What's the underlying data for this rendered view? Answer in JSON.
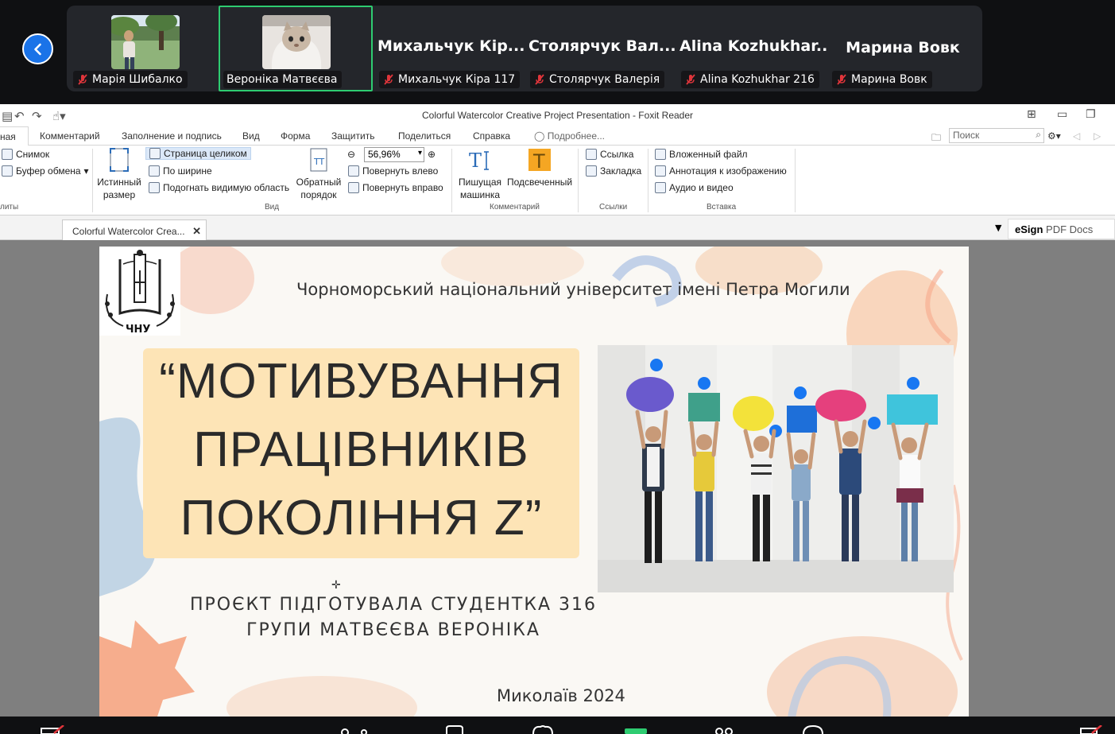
{
  "participants": [
    {
      "name": "Марія Шибалко",
      "muted": true,
      "has_video": true
    },
    {
      "name": "Вероніка Матвєєва",
      "muted": false,
      "has_video": true,
      "active": true
    },
    {
      "display": "Михальчук Кір...",
      "name": "Михальчук Кіра 117",
      "muted": true
    },
    {
      "display": "Столярчук Вал...",
      "name": "Столярчук Валерія",
      "muted": true
    },
    {
      "display": "Alina Kozhukhar...",
      "name": "Alina Kozhukhar 216",
      "muted": true
    },
    {
      "display": "Марина Вовк",
      "name": "Марина Вовк",
      "muted": true
    }
  ],
  "window": {
    "title": "Colorful Watercolor Creative Project Presentation - Foxit Reader"
  },
  "menu": {
    "home": "ная",
    "items": [
      "Комментарий",
      "Заполнение и подпись",
      "Вид",
      "Форма",
      "Защитить",
      "Поделиться",
      "Справка",
      "Подробнее..."
    ],
    "search_placeholder": "Поиск"
  },
  "ribbon": {
    "snapshot": "Снимок",
    "clipboard": "Буфер обмена",
    "tools_group": "литы",
    "actual_size": [
      "Истинный",
      "размер"
    ],
    "fit_page": "Страница целиком",
    "fit_width": "По ширине",
    "fit_visible": "Подогнать видимую область",
    "view_group": "Вид",
    "reverse_order": [
      "Обратный",
      "порядок"
    ],
    "zoom": "56,96%",
    "rotate_left": "Повернуть влево",
    "rotate_right": "Повернуть вправо",
    "typewriter": [
      "Пишущая",
      "машинка"
    ],
    "highlight": "Подсвеченный",
    "comments_group": "Комментарий",
    "link": "Ссылка",
    "bookmark": "Закладка",
    "links_group": "Ссылки",
    "attachment": "Вложенный файл",
    "image_annotation": "Аннотация к изображению",
    "audio_video": "Аудио и видео",
    "insert_group": "Вставка"
  },
  "tabs": {
    "doc_tab": "Colorful Watercolor Crea...",
    "close": "✕",
    "esign_bold": "eSign",
    "esign_rest": " PDF Docs"
  },
  "slide": {
    "logo_text": "ЧНУ",
    "university": "Чорноморський національний університет імені Петра Могили",
    "title_lines": [
      "“МОТИВУВАННЯ",
      "ПРАЦІВНИКІВ",
      "ПОКОЛІННЯ Z”"
    ],
    "author_lines": [
      "ПРОЄКТ ПІДГОТУВАЛА СТУДЕНТКА 316",
      "ГРУПИ МАТВЄЄВА ВЕРОНІКА"
    ],
    "city": "Миколаїв 2024"
  },
  "colors": {
    "zoom_bg": "#0f1012",
    "active_tile": "#2ecc71",
    "back_button": "#1a73e8",
    "title_box": "#fde4b6"
  }
}
